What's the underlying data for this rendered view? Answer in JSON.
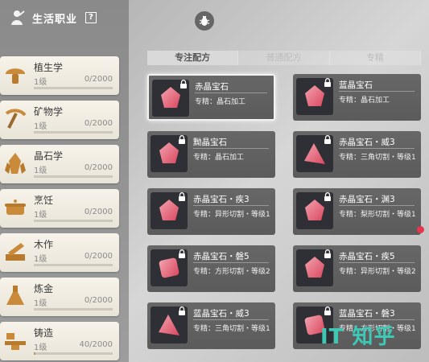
{
  "header": {
    "title": "生活职业",
    "help": "?"
  },
  "professions": [
    {
      "name": "植生学",
      "level": "1级",
      "exp": "0/2000",
      "progress": 0,
      "icon": "mushroom-icon"
    },
    {
      "name": "矿物学",
      "level": "1级",
      "exp": "0/2000",
      "progress": 0,
      "icon": "pickaxe-icon"
    },
    {
      "name": "晶石学",
      "level": "1级",
      "exp": "0/2000",
      "progress": 0,
      "icon": "crystal-icon"
    },
    {
      "name": "烹饪",
      "level": "1级",
      "exp": "0/2000",
      "progress": 0,
      "icon": "cooking-pot-icon"
    },
    {
      "name": "木作",
      "level": "1级",
      "exp": "0/2000",
      "progress": 0,
      "icon": "saw-icon"
    },
    {
      "name": "炼金",
      "level": "1级",
      "exp": "0/2000",
      "progress": 0,
      "icon": "flask-icon"
    },
    {
      "name": "铸造",
      "level": "1级",
      "exp": "40/2000",
      "progress": 0.02,
      "icon": "anvil-icon"
    }
  ],
  "tabs": [
    {
      "label": "专注配方",
      "active": true
    },
    {
      "label": "普通配方",
      "active": false
    },
    {
      "label": "专精",
      "active": false
    }
  ],
  "recipes": [
    {
      "name": "赤晶宝石",
      "req": "专精：晶石加工",
      "gem": "red",
      "selected": true
    },
    {
      "name": "蓝晶宝石",
      "req": "专精：晶石加工",
      "gem": "blue",
      "selected": false
    },
    {
      "name": "黝晶宝石",
      "req": "专精：晶石加工",
      "gem": "yellow",
      "selected": false
    },
    {
      "name": "赤晶宝石・威3",
      "req": "专精：三角切割・等级1",
      "gem": "red-tri",
      "selected": false
    },
    {
      "name": "赤晶宝石・疾3",
      "req": "专精：异形切割・等级1",
      "gem": "red",
      "selected": false
    },
    {
      "name": "赤晶宝石・渊3",
      "req": "专精：梨形切割・等级1",
      "gem": "red",
      "selected": false
    },
    {
      "name": "赤晶宝石・磐5",
      "req": "专精：方形切割・等级2",
      "gem": "red-sq",
      "selected": false
    },
    {
      "name": "赤晶宝石・疾5",
      "req": "专精：异形切割・等级2",
      "gem": "red",
      "selected": false
    },
    {
      "name": "蓝晶宝石・威3",
      "req": "专精：三角切割・等级1",
      "gem": "blue-tri",
      "selected": false
    },
    {
      "name": "蓝晶宝石・磐3",
      "req": "专精：方形切割・等级1",
      "gem": "blue-sq",
      "selected": false
    }
  ],
  "watermark": "IT 知乎"
}
